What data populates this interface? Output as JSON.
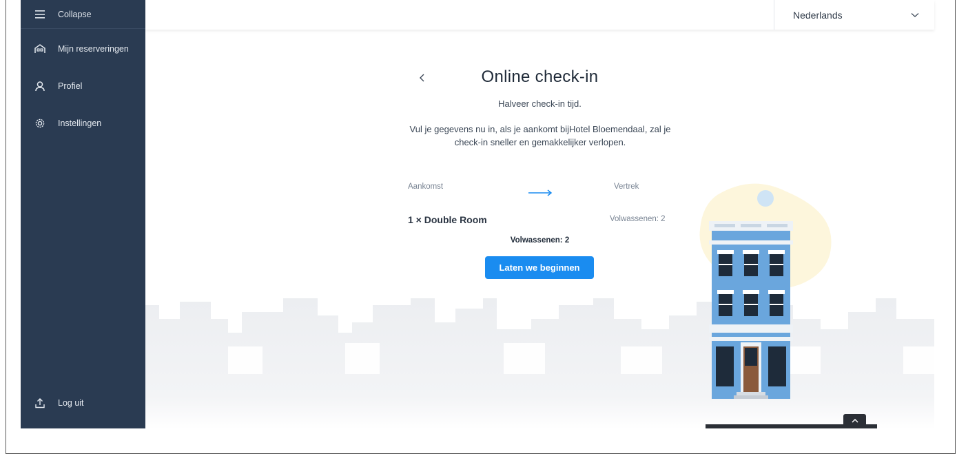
{
  "sidebar": {
    "collapse_label": "Collapse",
    "items": [
      {
        "label": "Mijn reserveringen",
        "icon": "hotel-icon"
      },
      {
        "label": "Profiel",
        "icon": "user-icon"
      },
      {
        "label": "Instellingen",
        "icon": "gear-icon"
      }
    ],
    "logout_label": "Log uit"
  },
  "header": {
    "language": "Nederlands"
  },
  "main": {
    "title": "Online check-in",
    "subtitle": "Halveer check-in tijd.",
    "description": "Vul je gegevens nu in, als je aankomt bijHotel Bloemendaal, zal je check-in sneller en gemakkelijker verlopen.",
    "arrival_label": "Aankomst",
    "departure_label": "Vertrek",
    "room": "1 × Double Room",
    "adults_right": "Volwassenen: 2",
    "adults_center": "Volwassenen: 2",
    "start_button": "Laten we beginnen"
  },
  "colors": {
    "sidebar_bg": "#2a3b52",
    "primary": "#1a8cf0"
  }
}
